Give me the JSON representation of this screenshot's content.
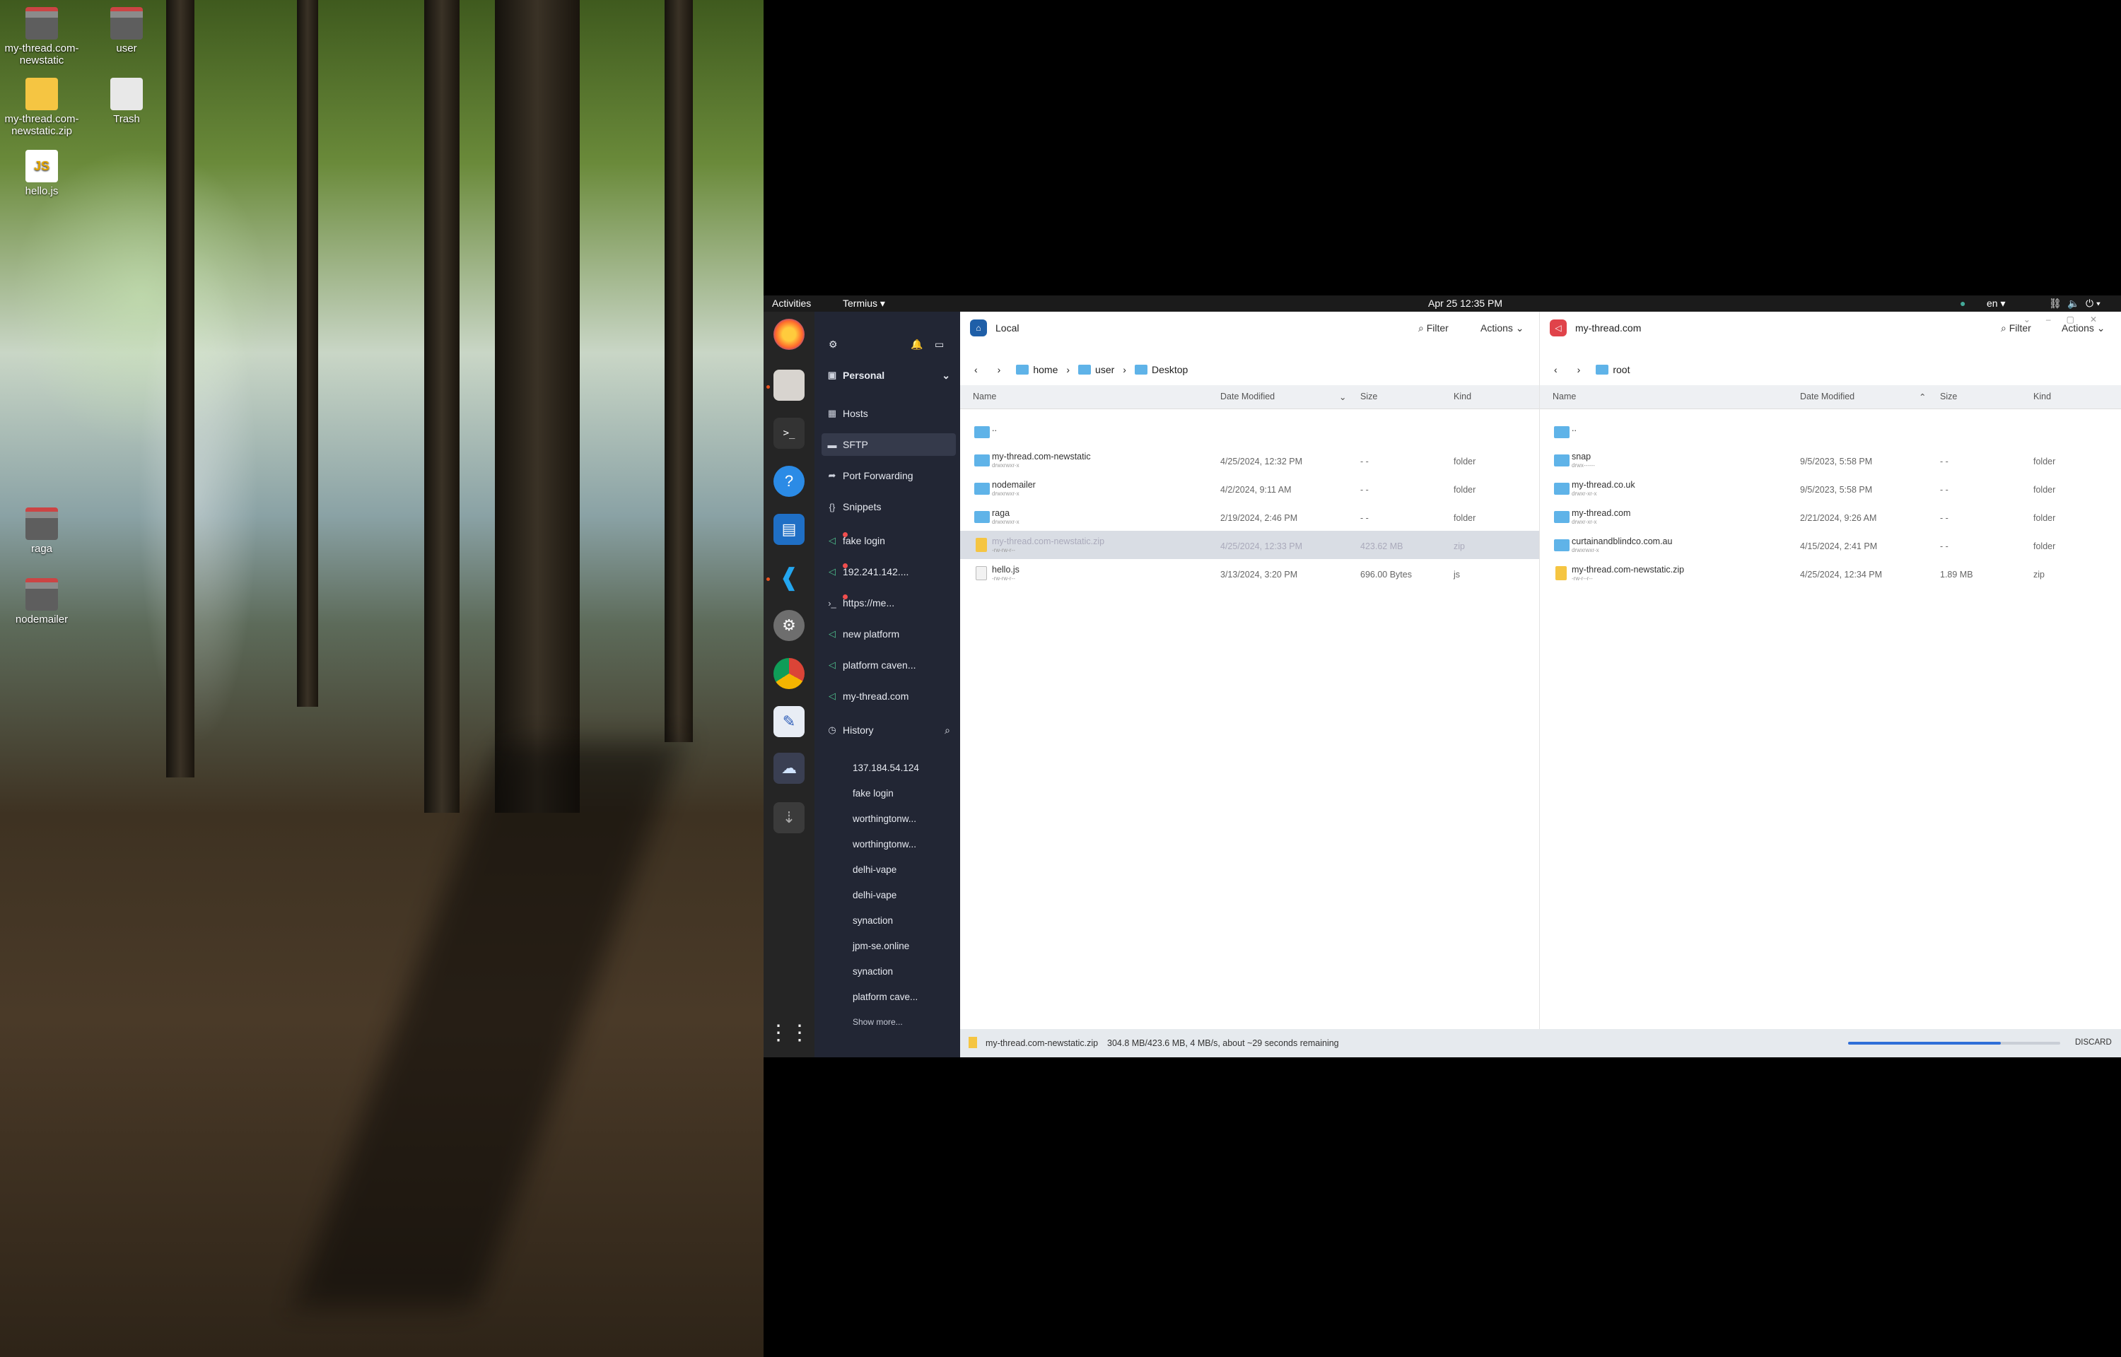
{
  "desktop": {
    "icons": [
      {
        "label": "my-thread.com-newstatic",
        "kind": "folder"
      },
      {
        "label": "user",
        "kind": "home"
      },
      {
        "label": "my-thread.com-newstatic.zip",
        "kind": "zip"
      },
      {
        "label": "Trash",
        "kind": "trash"
      },
      {
        "label": "hello.js",
        "kind": "js"
      },
      {
        "label": "raga",
        "kind": "folder"
      },
      {
        "label": "nodemailer",
        "kind": "folder"
      }
    ]
  },
  "topbar": {
    "activities": "Activities",
    "app": "Termius ▾",
    "clock": "Apr 25  12:35 PM",
    "lang": "en ▾"
  },
  "sidebar": {
    "vault": "Personal",
    "nav": [
      {
        "label": "Hosts"
      },
      {
        "label": "SFTP"
      },
      {
        "label": "Port Forwarding"
      },
      {
        "label": "Snippets"
      }
    ],
    "hosts": [
      {
        "label": "fake login"
      },
      {
        "label": "192.241.142...."
      },
      {
        "label": "https://me..."
      },
      {
        "label": "new platform"
      },
      {
        "label": "platform caven..."
      },
      {
        "label": "my-thread.com"
      }
    ],
    "history_label": "History",
    "history": [
      "137.184.54.124",
      "fake login",
      "worthingtonw...",
      "worthingtonw...",
      "delhi-vape",
      "delhi-vape",
      "synaction",
      "jpm-se.online",
      "synaction",
      "platform cave..."
    ],
    "show_more": "Show more..."
  },
  "local": {
    "title": "Local",
    "filter": "Filter",
    "actions": "Actions",
    "crumbs": [
      "home",
      "user",
      "Desktop"
    ],
    "cols": {
      "name": "Name",
      "date": "Date Modified",
      "size": "Size",
      "kind": "Kind"
    },
    "rows": [
      {
        "name": "..",
        "sub": "",
        "date": "",
        "size": "",
        "kind": "",
        "type": "folder"
      },
      {
        "name": "my-thread.com-newstatic",
        "sub": "drwxrwxr-x",
        "date": "4/25/2024, 12:32 PM",
        "size": "- -",
        "kind": "folder",
        "type": "folder"
      },
      {
        "name": "nodemailer",
        "sub": "drwxrwxr-x",
        "date": "4/2/2024, 9:11 AM",
        "size": "- -",
        "kind": "folder",
        "type": "folder"
      },
      {
        "name": "raga",
        "sub": "drwxrwxr-x",
        "date": "2/19/2024, 2:46 PM",
        "size": "- -",
        "kind": "folder",
        "type": "folder"
      },
      {
        "name": "my-thread.com-newstatic.zip",
        "sub": "-rw-rw-r--",
        "date": "4/25/2024, 12:33 PM",
        "size": "423.62 MB",
        "kind": "zip",
        "type": "zip",
        "selected": true
      },
      {
        "name": "hello.js",
        "sub": "-rw-rw-r--",
        "date": "3/13/2024, 3:20 PM",
        "size": "696.00 Bytes",
        "kind": "js",
        "type": "doc"
      }
    ]
  },
  "remote": {
    "title": "my-thread.com",
    "filter": "Filter",
    "actions": "Actions",
    "crumbs": [
      "root"
    ],
    "cols": {
      "name": "Name",
      "date": "Date Modified",
      "size": "Size",
      "kind": "Kind"
    },
    "rows": [
      {
        "name": "..",
        "sub": "",
        "date": "",
        "size": "",
        "kind": "",
        "type": "folder"
      },
      {
        "name": "snap",
        "sub": "drwx------",
        "date": "9/5/2023, 5:58 PM",
        "size": "- -",
        "kind": "folder",
        "type": "folder"
      },
      {
        "name": "my-thread.co.uk",
        "sub": "drwxr-xr-x",
        "date": "9/5/2023, 5:58 PM",
        "size": "- -",
        "kind": "folder",
        "type": "folder"
      },
      {
        "name": "my-thread.com",
        "sub": "drwxr-xr-x",
        "date": "2/21/2024, 9:26 AM",
        "size": "- -",
        "kind": "folder",
        "type": "folder"
      },
      {
        "name": "curtainandblindco.com.au",
        "sub": "drwxrwxr-x",
        "date": "4/15/2024, 2:41 PM",
        "size": "- -",
        "kind": "folder",
        "type": "folder"
      },
      {
        "name": "my-thread.com-newstatic.zip",
        "sub": "-rw-r--r--",
        "date": "4/25/2024, 12:34 PM",
        "size": "1.89 MB",
        "kind": "zip",
        "type": "zip"
      }
    ]
  },
  "status": {
    "file": "my-thread.com-newstatic.zip",
    "progress_text": "304.8 MB/423.6 MB, 4 MB/s, about ~29 seconds remaining",
    "progress": 0.72,
    "discard": "DISCARD"
  }
}
